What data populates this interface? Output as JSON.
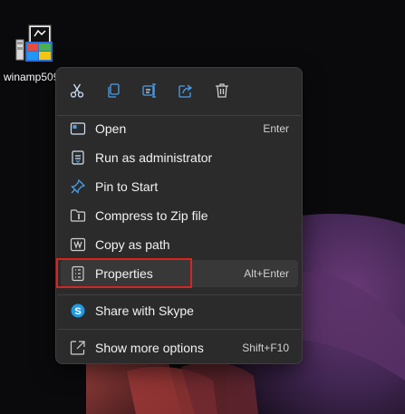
{
  "desktop": {
    "icon_label": "winamp509"
  },
  "quick_actions": [
    {
      "icon": "cut-icon"
    },
    {
      "icon": "copy-icon"
    },
    {
      "icon": "rename-icon"
    },
    {
      "icon": "share-icon"
    },
    {
      "icon": "delete-icon"
    }
  ],
  "menu": {
    "items": [
      {
        "label": "Open",
        "shortcut": "Enter",
        "icon": "open-app-icon"
      },
      {
        "label": "Run as administrator",
        "shortcut": "",
        "icon": "shield-icon"
      },
      {
        "label": "Pin to Start",
        "shortcut": "",
        "icon": "pin-icon"
      },
      {
        "label": "Compress to Zip file",
        "shortcut": "",
        "icon": "zip-folder-icon"
      },
      {
        "label": "Copy as path",
        "shortcut": "",
        "icon": "copy-path-icon"
      },
      {
        "label": "Properties",
        "shortcut": "Alt+Enter",
        "icon": "properties-icon"
      },
      {
        "label": "Share with Skype",
        "shortcut": "",
        "icon": "skype-icon"
      },
      {
        "label": "Show more options",
        "shortcut": "Shift+F10",
        "icon": "more-options-icon"
      }
    ]
  },
  "colors": {
    "menu_bg": "#2b2b2b",
    "accent_blue": "#4c9ee8",
    "highlight_red": "#e0201c"
  }
}
